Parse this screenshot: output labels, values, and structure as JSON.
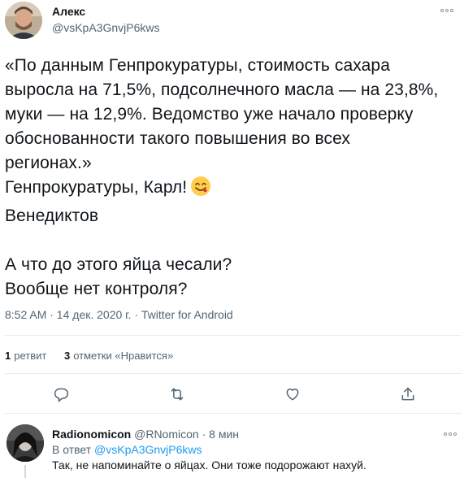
{
  "author": {
    "name": "Алекс",
    "handle": "@vsKpA3GnvjP6kws"
  },
  "tweet": {
    "lines": [
      "«По данным Генпрокуратуры, стоимость сахара",
      "выросла на 71,5%, подсолнечного масла — на 23,8%,",
      "муки — на 12,9%. Ведомство уже начало проверку",
      "обоснованности такого повышения во всех",
      "регионах.»",
      "Генпрокуратуры, Карл!",
      "Венедиктов",
      "",
      "А что до этого яйца чесали?",
      "Вообще нет контроля?"
    ],
    "emoji": "face-savoring-food-emoji"
  },
  "meta": {
    "time": "8:52 AM · 14 дек. 2020 г. · ",
    "source": "Twitter for Android"
  },
  "stats": {
    "retweets_count": "1",
    "retweets_label": "ретвит",
    "likes_count": "3",
    "likes_label": "отметки «Нравится»"
  },
  "actions": {
    "reply_icon": "reply-icon",
    "retweet_icon": "retweet-icon",
    "like_icon": "heart-icon",
    "share_icon": "share-icon"
  },
  "reply": {
    "name": "Radionomicon",
    "handle": "@RNomicon",
    "time": "· 8 мин",
    "reply_to_prefix": "В ответ ",
    "reply_to_handle": "@vsKpA3GnvjP6kws",
    "text": "Так, не напоминайте о яйцах. Они тоже подорожают нахуй."
  },
  "colors": {
    "accent": "#1d9bf0",
    "secondary_text": "#536471",
    "icon": "#536471",
    "divider": "#e6ecf0"
  }
}
